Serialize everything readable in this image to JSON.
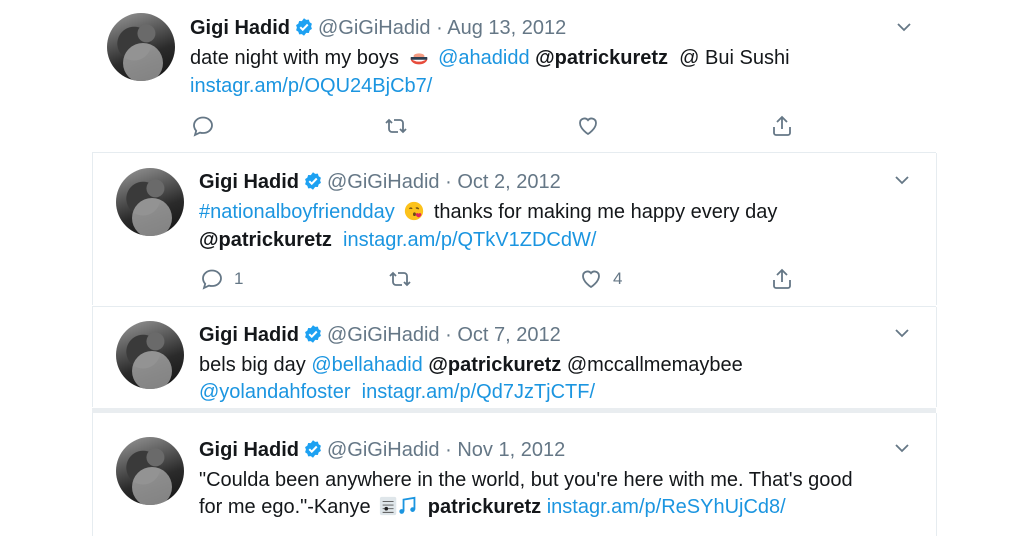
{
  "tweets": [
    {
      "name": "Gigi Hadid",
      "handle": "@GiGiHadid",
      "separator": "·",
      "date": "Aug 13, 2012",
      "line1": {
        "text_a": "date night with my boys",
        "emoji": "sushi-emoji",
        "mention_a": "@ahadidd",
        "mention_b": "@patrickuretz",
        "location": "@ Bui Sushi"
      },
      "link": "instagr.am/p/OQU24BjCb7/",
      "reply_count": "",
      "like_count": ""
    },
    {
      "name": "Gigi Hadid",
      "handle": "@GiGiHadid",
      "separator": "·",
      "date": "Oct 2, 2012",
      "hashtag": "#nationalboyfriendday",
      "emoji": "kiss-emoji",
      "text_a": "thanks for making me happy every day",
      "mention": "@patrickuretz",
      "link": "instagr.am/p/QTkV1ZDCdW/",
      "reply_count": "1",
      "like_count": "4"
    },
    {
      "name": "Gigi Hadid",
      "handle": "@GiGiHadid",
      "separator": "·",
      "date": "Oct 7, 2012",
      "text_a": "bels big day",
      "mention_a": "@bellahadid",
      "mention_b": "@patrickuretz",
      "mention_c": "@mccallmemaybee",
      "mention_d": "@yolandahfoster",
      "link": "instagr.am/p/Qd7JzTjCTF/"
    },
    {
      "name": "Gigi Hadid",
      "handle": "@GiGiHadid",
      "separator": "·",
      "date": "Nov 1, 2012",
      "line1": "\"Coulda been anywhere in the world, but you're here with me. That's good",
      "line2_a": "for me ego.\"-Kanye",
      "emoji": "music-emoji",
      "mention": "patrickuretz",
      "link": "instagr.am/p/ReSYhUjCd8/"
    }
  ],
  "colors": {
    "link": "#1b95e0",
    "muted": "#657786",
    "verified": "#1da1f2"
  }
}
